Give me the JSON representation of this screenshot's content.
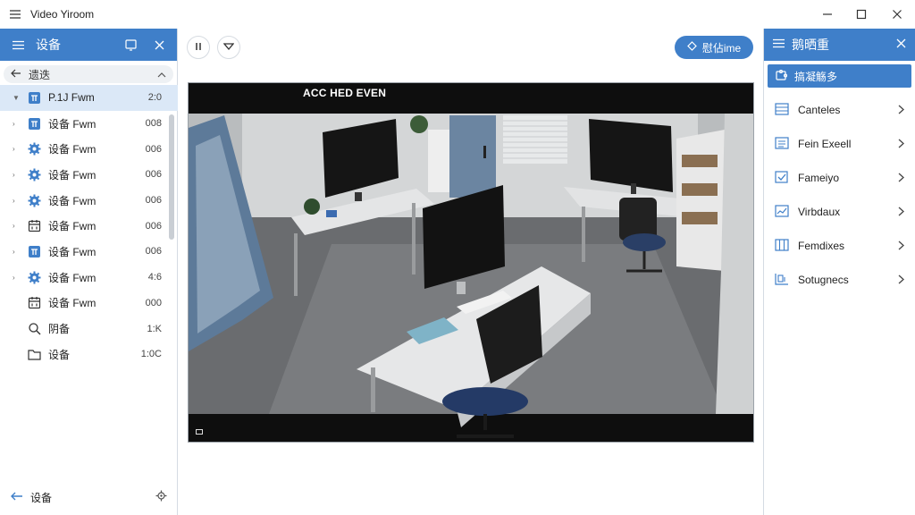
{
  "window": {
    "title": "Video Yiroom",
    "menu_icon": "hamburger-icon",
    "controls": [
      "minimize-icon",
      "maximize-icon",
      "close-icon"
    ]
  },
  "left_panel": {
    "header": {
      "title": "设备",
      "icons": [
        "hamburger-icon",
        "window-icon",
        "close-icon"
      ]
    },
    "search": {
      "text": "遗迭",
      "back_icon": "back-arrow-icon",
      "chevron_icon": "chevron-up-icon"
    },
    "items": [
      {
        "name": "P.1J Fwm",
        "value": "2:0",
        "icon": "camera-box-icon",
        "expander": "▼",
        "selected": true
      },
      {
        "name": "设备 Fwm",
        "value": "008",
        "icon": "camera-box-icon",
        "expander": "›"
      },
      {
        "name": "设备 Fwm",
        "value": "006",
        "icon": "gear-icon",
        "expander": "›"
      },
      {
        "name": "设备 Fwm",
        "value": "006",
        "icon": "gear-icon",
        "expander": "›"
      },
      {
        "name": "设备 Fwm",
        "value": "006",
        "icon": "gear-icon",
        "expander": "›"
      },
      {
        "name": "设备 Fwm",
        "value": "006",
        "icon": "calendar-icon",
        "expander": "›"
      },
      {
        "name": "设备 Fwm",
        "value": "006",
        "icon": "camera-box-icon",
        "expander": "›"
      },
      {
        "name": "设备 Fwm",
        "value": "4:6",
        "icon": "gear-icon",
        "expander": "›"
      },
      {
        "name": "设备 Fwm",
        "value": "000",
        "icon": "calendar-icon",
        "expander": ""
      },
      {
        "name": "阴备",
        "value": "1:K",
        "icon": "search-icon",
        "expander": ""
      },
      {
        "name": "设备",
        "value": "1:0C",
        "icon": "folder-icon",
        "expander": ""
      }
    ],
    "footer": {
      "label": "设备",
      "back_icon": "back-arrow-icon",
      "settings_icon": "gear-icon"
    }
  },
  "center": {
    "tools": [
      {
        "icon": "pause-icon"
      },
      {
        "icon": "shield-down-icon"
      }
    ],
    "live_button": {
      "label": "慰佔ime",
      "icon": "diamond-icon"
    },
    "video": {
      "overlay_text": "ACC HED EVEN"
    }
  },
  "right_panel": {
    "header": {
      "title": "鹅晒重",
      "icon": "hamburger-icon",
      "close_icon": "close-icon"
    },
    "selected_item": {
      "label": "搞凝觞多",
      "icon": "puzzle-icon"
    },
    "items": [
      {
        "label": "Canteles",
        "icon": "grid-icon"
      },
      {
        "label": "Fein Exeell",
        "icon": "list-icon"
      },
      {
        "label": "Fameiyo",
        "icon": "checkbox-icon"
      },
      {
        "label": "Virbdaux",
        "icon": "chart-icon"
      },
      {
        "label": "Femdixes",
        "icon": "columns-icon"
      },
      {
        "label": "Sotugnecs",
        "icon": "layout-icon"
      }
    ]
  },
  "colors": {
    "accent": "#3f7fc9",
    "selection": "#dbe8f7",
    "border": "#d5dbe3"
  }
}
